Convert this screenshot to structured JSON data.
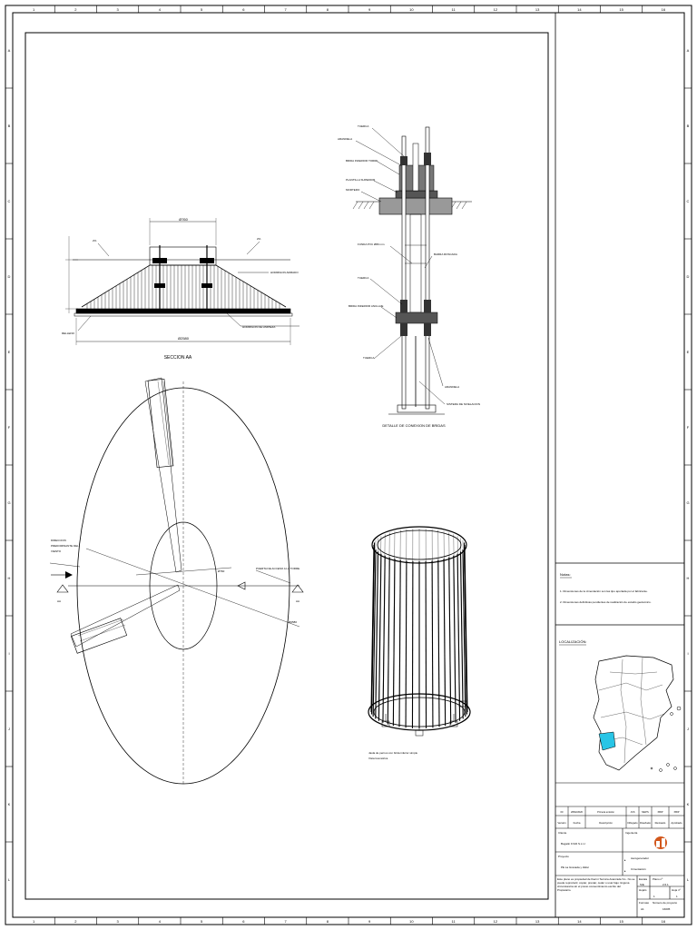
{
  "border": {
    "col_labels": [
      "1",
      "2",
      "3",
      "4",
      "5",
      "6",
      "7",
      "8",
      "9",
      "10",
      "11",
      "12",
      "13",
      "14",
      "15",
      "16"
    ],
    "row_labels": [
      "A",
      "B",
      "C",
      "D",
      "E",
      "F",
      "G",
      "H",
      "I",
      "J",
      "K",
      "L"
    ]
  },
  "section_aa": {
    "title": "SECCION AA",
    "dim_top": "Ø760",
    "dim_bottom": "Ø2580",
    "label_relleno": "RELLENO",
    "label_hormigon_armado": "HORMIGON ARMADO",
    "label_hormigon_limpieza": "HORMIGON DE LIMPIEZA",
    "slope_left": "2%",
    "slope_right": "2%"
  },
  "flange_detail": {
    "title": "DETALLE DE CONEXION DE BRIDAS",
    "labels": {
      "tuerca_top": "TUERCA",
      "arandela_top": "ARANDELA",
      "brida_torre": "BRIDA INFERIOR TORRE",
      "plantilla": "PLANTILLA SUPERIOR",
      "mortero": "MORTERO",
      "funda": "FUNDA PVC Ø80 mm",
      "barra": "BARRA ROSCADA",
      "tuerca_mid": "TUERCA",
      "brida_anclaje": "BRIDA INFERIOR ANCLAJE",
      "tuerca_low": "TUERCA",
      "arandela_low": "ARANDELA",
      "sistema": "SISTEMA DE NIVELACION"
    }
  },
  "plan_view": {
    "wind_label_lines": [
      "DIRECCION",
      "PREDOMINANTE DEL",
      "VIENTO"
    ],
    "door_label": "PUERTA DE ACCESO A LA TORRE",
    "aa_left": "AA",
    "aa_right": "AA",
    "dim_small": "Ø760",
    "dim_large": "Ø2580"
  },
  "cage_view": {
    "caption_lines": [
      "Jaula de pernos con brida inferior simple",
      "Vista Isométrica"
    ]
  },
  "notes": {
    "heading": "Notas:",
    "items": [
      "1.   Dimensiones de la cimentación son las tipo aportada por el fabricante.",
      "2.   Dimensiones definitivas pendientes de realización de estudio geotécnico."
    ]
  },
  "location": {
    "heading": "LOCALIZACIÓN:",
    "highlight_color": "#29c5e6"
  },
  "title_block": {
    "revision_row": [
      "00",
      "28/02/2020",
      "Primera emisión",
      "JCS",
      "MHPS",
      "XBIP",
      "XBIP"
    ],
    "revision_headers": [
      "Versión",
      "Fecha",
      "Descripción",
      "Dibujado",
      "Diseñado",
      "Revisado",
      "Aprobado"
    ],
    "client_label": "Cliente",
    "client_value": "Bogatin FV22 S.L.U.",
    "engineering_label": "Ingeniería",
    "project_label": "Proyecto",
    "project_value": "PE La Granada y Zafar",
    "subject_line1": "Aerogenerador",
    "subject_line2": "Cimentación",
    "escala_label": "Escala",
    "escala_value": "S/E",
    "plano_label": "Plano nº",
    "plano_value": "2.6.1",
    "hojas_label": "Hoja/s",
    "hojas_value": "1",
    "hojas_de_label": "Hoja nº",
    "hojas_de_value": "1",
    "formato_label": "Formato",
    "formato_value": "A1",
    "numero_label": "Número de proyecto",
    "numero_value": "16005",
    "legal": "Este plano es propiedad de Ibermi Tecnica Avanzada S.L. No se puede reproducir, copiar, prestar, ceder o usar bajo ninguna circunstancia sin el previo consentimiento escrito del Propietario.",
    "logo_color": "#d2571c"
  }
}
